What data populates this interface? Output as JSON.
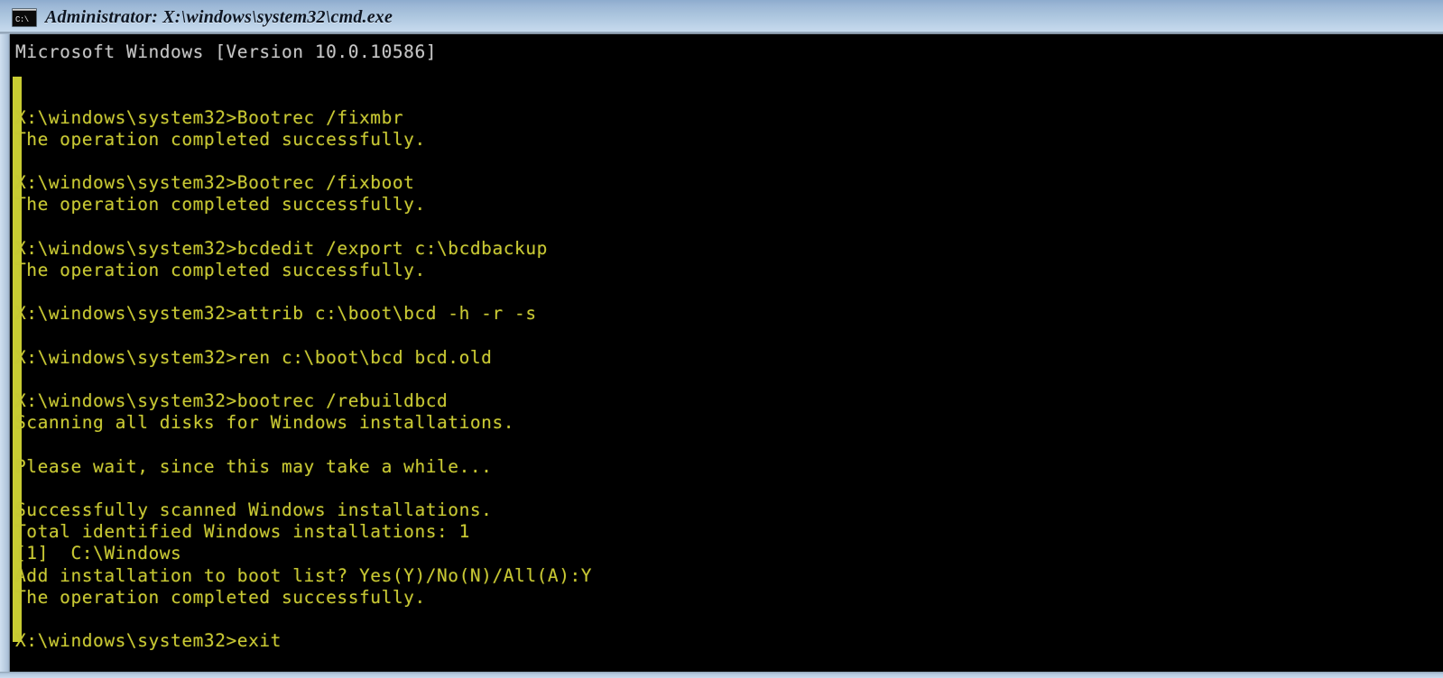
{
  "window": {
    "title": "Administrator: X:\\windows\\system32\\cmd.exe",
    "icon": "cmd-console-icon",
    "icon_glyph": "C:\\",
    "titlebar_color_top": "#8eacce",
    "titlebar_color_bottom": "#cadcee",
    "frame_color": "#c3d6ea"
  },
  "console": {
    "background_color": "#000000",
    "text_color": "#c9c933",
    "header_text_color": "#c6c6c6",
    "highlight_stripe_color": "#c9cc33",
    "lines": [
      {
        "text": "Microsoft Windows [Version 10.0.10586]",
        "style": "header"
      },
      {
        "text": "",
        "style": "blank"
      },
      {
        "text": "",
        "style": "blank"
      },
      {
        "text": "X:\\windows\\system32>Bootrec /fixmbr",
        "style": "normal"
      },
      {
        "text": "The operation completed successfully.",
        "style": "normal"
      },
      {
        "text": "",
        "style": "blank"
      },
      {
        "text": "X:\\windows\\system32>Bootrec /fixboot",
        "style": "normal"
      },
      {
        "text": "The operation completed successfully.",
        "style": "normal"
      },
      {
        "text": "",
        "style": "blank"
      },
      {
        "text": "X:\\windows\\system32>bcdedit /export c:\\bcdbackup",
        "style": "normal"
      },
      {
        "text": "The operation completed successfully.",
        "style": "normal"
      },
      {
        "text": "",
        "style": "blank"
      },
      {
        "text": "X:\\windows\\system32>attrib c:\\boot\\bcd -h -r -s",
        "style": "normal"
      },
      {
        "text": "",
        "style": "blank"
      },
      {
        "text": "X:\\windows\\system32>ren c:\\boot\\bcd bcd.old",
        "style": "normal"
      },
      {
        "text": "",
        "style": "blank"
      },
      {
        "text": "X:\\windows\\system32>bootrec /rebuildbcd",
        "style": "normal"
      },
      {
        "text": "Scanning all disks for Windows installations.",
        "style": "normal"
      },
      {
        "text": "",
        "style": "blank"
      },
      {
        "text": "Please wait, since this may take a while...",
        "style": "normal"
      },
      {
        "text": "",
        "style": "blank"
      },
      {
        "text": "Successfully scanned Windows installations.",
        "style": "normal"
      },
      {
        "text": "Total identified Windows installations: 1",
        "style": "normal"
      },
      {
        "text": "[1]  C:\\Windows",
        "style": "normal"
      },
      {
        "text": "Add installation to boot list? Yes(Y)/No(N)/All(A):Y",
        "style": "normal"
      },
      {
        "text": "The operation completed successfully.",
        "style": "normal"
      },
      {
        "text": "",
        "style": "blank"
      },
      {
        "text": "X:\\windows\\system32>exit",
        "style": "normal"
      }
    ]
  }
}
